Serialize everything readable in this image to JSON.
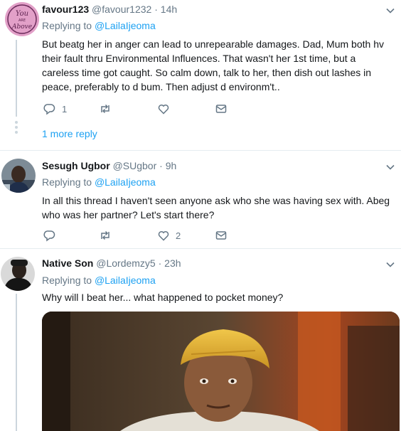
{
  "tweets": [
    {
      "name": "favour123",
      "handle": "@favour1232",
      "sep": " · ",
      "time": "14h",
      "replying_prefix": "Replying to ",
      "replying_to": "@LailaIjeoma",
      "text": "But beatg her in anger can lead to unrepearable damages. Dad, Mum both hv their fault thru Environmental Influences. That wasn't her 1st time, but a careless time got caught. So calm down, talk to her, then dish out lashes in peace, preferably to d bum. Then adjust d environm't..",
      "reply_count": "1",
      "retweet_count": "",
      "like_count": "",
      "avatar_text": "You Are Above"
    },
    {
      "name": "Sesugh Ugbor",
      "handle": "@SUgbor",
      "sep": " · ",
      "time": "9h",
      "replying_prefix": "Replying to ",
      "replying_to": "@LailaIjeoma",
      "text": "In all this thread I haven't seen anyone ask who she was having sex  with. Abeg who was her partner? Let's start there?",
      "reply_count": "",
      "retweet_count": "",
      "like_count": "2"
    },
    {
      "name": "Native Son",
      "handle": "@Lordemzy5",
      "sep": " · ",
      "time": "23h",
      "replying_prefix": "Replying to ",
      "replying_to": "@LailaIjeoma",
      "text": "Why will I beat her... what happened to pocket money?",
      "reply_count": "",
      "retweet_count": "",
      "like_count": ""
    }
  ],
  "more_replies": "1 more reply",
  "colors": {
    "link": "#1da1f2",
    "muted": "#657786",
    "text": "#14171a",
    "border": "#e6ecf0"
  }
}
